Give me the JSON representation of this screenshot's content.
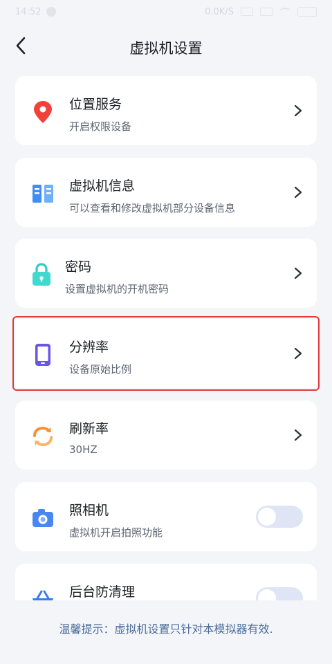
{
  "status_bar": {
    "time": "14:52",
    "net_speed": "0.0K/S"
  },
  "header": {
    "title": "虚拟机设置"
  },
  "settings": [
    {
      "title": "位置服务",
      "subtitle": "开启权限设备",
      "icon": "location-pin-icon",
      "control": "chevron"
    },
    {
      "title": "虚拟机信息",
      "subtitle": "可以查看和修改虚拟机部分设备信息",
      "icon": "server-info-icon",
      "control": "chevron"
    },
    {
      "title": "密码",
      "subtitle": "设置虚拟机的开机密码",
      "icon": "lock-icon",
      "control": "chevron"
    },
    {
      "title": "分辨率",
      "subtitle": "设备原始比例",
      "icon": "phone-screen-icon",
      "control": "chevron",
      "selected": true
    },
    {
      "title": "刷新率",
      "subtitle": "30HZ",
      "icon": "refresh-icon",
      "control": "chevron"
    },
    {
      "title": "照相机",
      "subtitle": "虚拟机开启拍照功能",
      "icon": "camera-icon",
      "control": "toggle",
      "enabled": false
    },
    {
      "title": "后台防清理",
      "subtitle": "",
      "icon": "basket-icon",
      "control": "toggle",
      "enabled": false
    }
  ],
  "footer": {
    "tip": "温馨提示：虚拟机设置只针对本模拟器有效."
  },
  "colors": {
    "background": "#f3f5f9",
    "card": "#ffffff",
    "selection_border": "#e03b3b",
    "tip_text": "#4b6b99",
    "toggle_off": "#dfe5f4"
  }
}
